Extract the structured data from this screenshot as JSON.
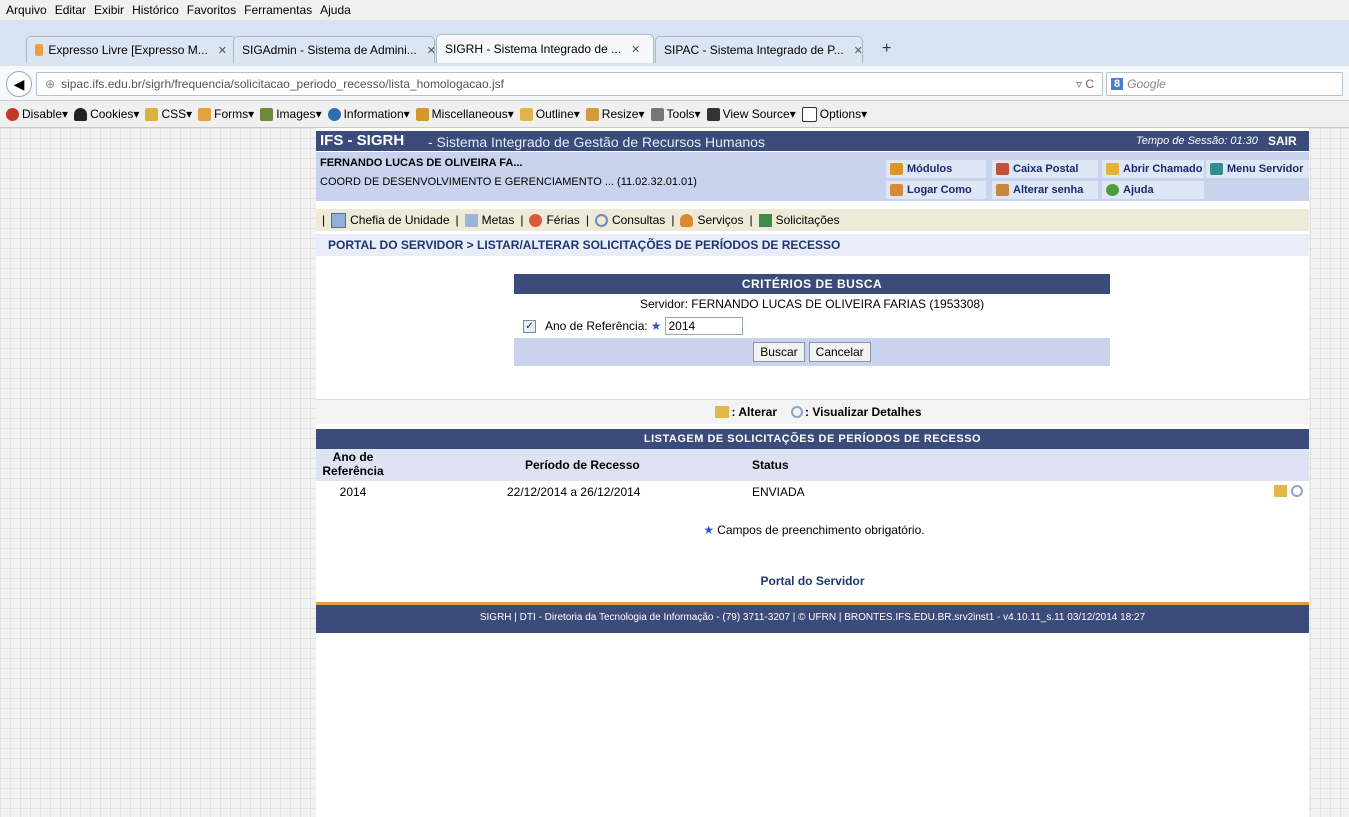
{
  "browser": {
    "menu": [
      "Arquivo",
      "Editar",
      "Exibir",
      "Histórico",
      "Favoritos",
      "Ferramentas",
      "Ajuda"
    ],
    "tabs": [
      {
        "label": "Expresso Livre [Expresso M...",
        "active": false
      },
      {
        "label": "SIGAdmin - Sistema de Admini...",
        "active": false
      },
      {
        "label": "SIGRH - Sistema Integrado de ...",
        "active": true
      },
      {
        "label": "SIPAC - Sistema Integrado de P...",
        "active": false
      }
    ],
    "newtab": "+",
    "url": "sipac.ifs.edu.br/sigrh/frequencia/solicitacao_periodo_recesso/lista_homologacao.jsf",
    "search_placeholder": "Google",
    "devbar": [
      "Disable",
      "Cookies",
      "CSS",
      "Forms",
      "Images",
      "Information",
      "Miscellaneous",
      "Outline",
      "Resize",
      "Tools",
      "View Source",
      "Options"
    ]
  },
  "header": {
    "system": "IFS - SIGRH",
    "description": "- Sistema Integrado de Gestão de Recursos Humanos",
    "session_label": "Tempo de Sessão: 01:30",
    "logout": "SAIR"
  },
  "user": {
    "name": "FERNANDO LUCAS DE OLIVEIRA FA...",
    "unit": "COORD DE DESENVOLVIMENTO E GERENCIAMENTO ... (11.02.32.01.01)",
    "buttons": {
      "modulos": "Módulos",
      "caixa": "Caixa Postal",
      "chamado": "Abrir Chamado",
      "menu_servidor": "Menu Servidor",
      "logar": "Logar Como",
      "senha": "Alterar senha",
      "ajuda": "Ajuda"
    }
  },
  "menu": {
    "chefia": "Chefia de Unidade",
    "metas": "Metas",
    "ferias": "Férias",
    "consultas": "Consultas",
    "servicos": "Serviços",
    "solicitacoes": "Solicitações"
  },
  "breadcrumb": "PORTAL DO SERVIDOR > LISTAR/ALTERAR SOLICITAÇÕES DE PERÍODOS DE RECESSO",
  "search": {
    "caption": "CRITÉRIOS DE BUSCA",
    "servidor": "Servidor: FERNANDO LUCAS DE OLIVEIRA FARIAS (1953308)",
    "ano_label": "Ano de Referência:",
    "ano_value": "2014",
    "buscar": "Buscar",
    "cancelar": "Cancelar"
  },
  "legend": {
    "alterar": ": Alterar",
    "visualizar": ": Visualizar Detalhes"
  },
  "listing": {
    "caption": "LISTAGEM DE SOLICITAÇÕES DE PERÍODOS DE RECESSO",
    "headers": {
      "ano": "Ano de Referência",
      "periodo": "Período de Recesso",
      "status": "Status"
    },
    "rows": [
      {
        "ano": "2014",
        "periodo": "22/12/2014 a 26/12/2014",
        "status": "ENVIADA"
      }
    ]
  },
  "required_note": "Campos de preenchimento obrigatório.",
  "portal_link": "Portal do Servidor",
  "footer": "SIGRH | DTI - Diretoria da Tecnologia de Informação - (79) 3711-3207 | © UFRN | BRONTES.IFS.EDU.BR.srv2inst1 - v4.10.11_s.11 03/12/2014 18:27",
  "colors": {
    "header": "#3b4b7a",
    "userbar": "#c9d3ee",
    "menu": "#efe9d8",
    "footer_accent": "#d8a33c"
  }
}
